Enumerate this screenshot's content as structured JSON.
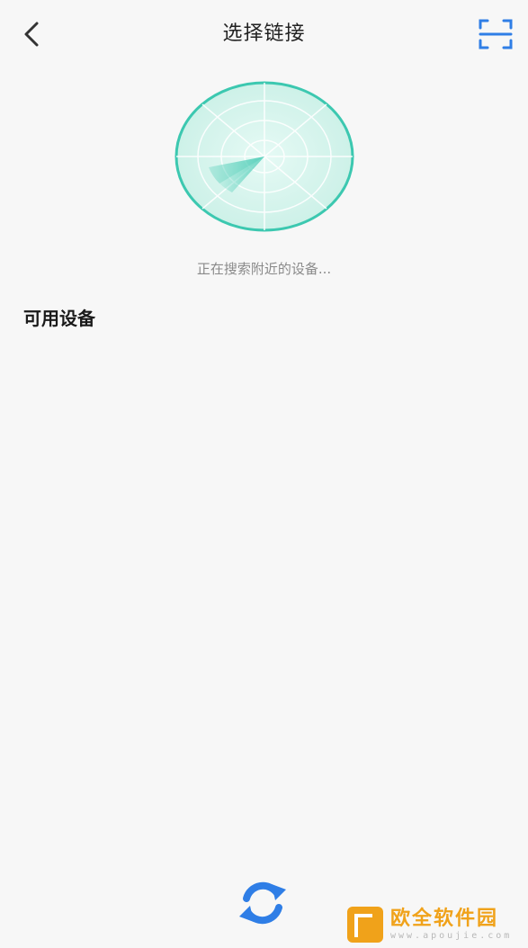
{
  "header": {
    "title": "选择链接",
    "back_icon": "chevron-left-icon",
    "scan_icon": "scan-icon"
  },
  "radar": {
    "status_text": "正在搜索附近的设备...",
    "accent_color": "#3cc8b0",
    "fill_color": "#d6f5ee"
  },
  "devices": {
    "section_title": "可用设备",
    "items": []
  },
  "refresh": {
    "icon": "refresh-icon",
    "color": "#2f7ee6"
  },
  "watermark": {
    "name": "欧全软件园",
    "url": "www.apoujie.com"
  }
}
